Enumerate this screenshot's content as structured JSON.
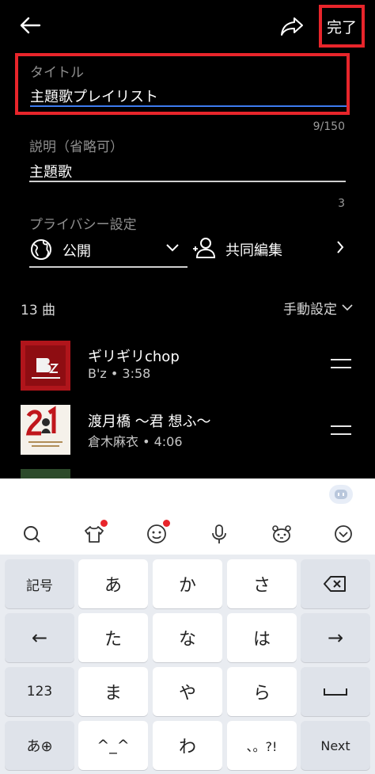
{
  "header": {
    "done_label": "完了",
    "back_icon": "back-arrow-icon",
    "share_icon": "share-icon"
  },
  "form": {
    "title_label": "タイトル",
    "title_value": "主題歌プレイリスト",
    "title_counter": "9/150",
    "description_label": "説明（省略可）",
    "description_value": "主題歌",
    "description_counter": "3",
    "privacy_label": "プライバシー設定",
    "privacy_value": "公開",
    "collab_label": "共同編集"
  },
  "playlist": {
    "count_label": "13 曲",
    "sort_label": "手動設定",
    "songs": [
      {
        "title": "ギリギリchop",
        "subtitle": "B'z • 3:58"
      },
      {
        "title": "渡月橋 〜君 想ふ〜",
        "subtitle": "倉木麻衣 • 4:06"
      }
    ]
  },
  "keyboard": {
    "rows": [
      [
        "記号",
        "あ",
        "か",
        "さ",
        "⌫"
      ],
      [
        "←",
        "た",
        "な",
        "は",
        "→"
      ],
      [
        "123",
        "ま",
        "や",
        "ら",
        "␣"
      ],
      [
        "あ⊕",
        "^_^",
        "わ",
        "、。?!",
        "Next"
      ]
    ]
  },
  "colors": {
    "highlight": "#e8252b",
    "focus_underline": "#3d7bf0",
    "background": "#000000",
    "keyboard_bg": "#e9ecf1"
  }
}
